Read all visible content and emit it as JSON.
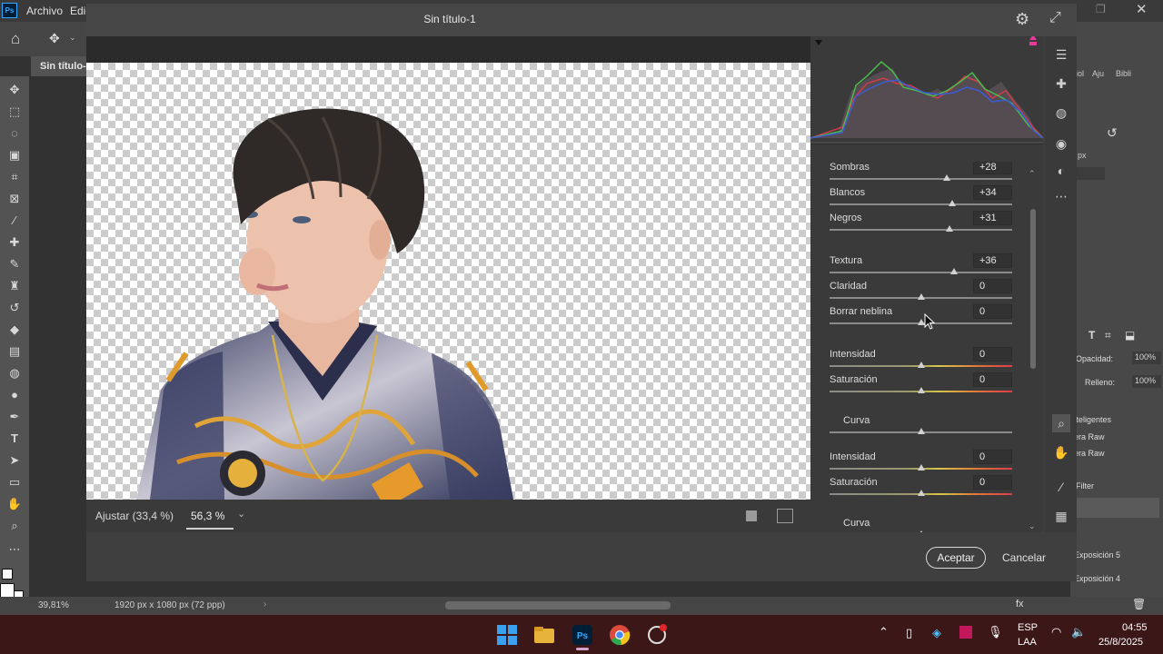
{
  "app": {
    "logo": "Ps",
    "menu": [
      "Archivo",
      "Edic"
    ],
    "doc_tab": "Sin título-",
    "status_zoom": "39,81%",
    "status_info": "1920 px x 1080 px (72 ppp)"
  },
  "dialog": {
    "title": "Sin título-1",
    "zoom_fit": "Ajustar (33,4 %)",
    "zoom_current": "56,3 %",
    "ok_label": "Aceptar",
    "cancel_label": "Cancelar"
  },
  "sliders": [
    {
      "label": "Sombras",
      "value": "+28",
      "level": 0.64,
      "color": false
    },
    {
      "label": "Blancos",
      "value": "+34",
      "level": 0.67,
      "color": false
    },
    {
      "label": "Negros",
      "value": "+31",
      "level": 0.655,
      "color": false
    },
    {
      "label": "Textura",
      "value": "+36",
      "level": 0.68,
      "color": false
    },
    {
      "label": "Claridad",
      "value": "0",
      "level": 0.5,
      "color": false
    },
    {
      "label": "Borrar neblina",
      "value": "0",
      "level": 0.5,
      "color": false
    },
    {
      "label": "Intensidad",
      "value": "0",
      "level": 0.5,
      "color": true
    },
    {
      "label": "Saturación",
      "value": "0",
      "level": 0.5,
      "color": true
    },
    {
      "label": "Curva",
      "value": "",
      "level": 0.5,
      "color": false
    },
    {
      "label": "Intensidad",
      "value": "0",
      "level": 0.5,
      "color": true
    },
    {
      "label": "Saturación",
      "value": "0",
      "level": 0.5,
      "color": true
    },
    {
      "label": "Curva",
      "value": "",
      "level": 0.5,
      "color": false
    }
  ],
  "right_panel": {
    "tabs": [
      "iol",
      "Aju",
      "Bibli"
    ],
    "unit": "px",
    "opacity_label": "Opacidad:",
    "opacity_value": "100%",
    "fill_label": "Relleno:",
    "fill_value": "100%",
    "layers": [
      "ıteligentes",
      "era Raw",
      "era Raw",
      "Filter"
    ],
    "exposures": [
      "Exposición 5",
      "Exposición 4"
    ]
  },
  "taskbar": {
    "lang1": "ESP",
    "lang2": "LAA",
    "time": "04:55",
    "date": "25/8/2025"
  },
  "colors": {
    "accent": "#31a8ff",
    "taskbar_bg": "#3c1718"
  }
}
